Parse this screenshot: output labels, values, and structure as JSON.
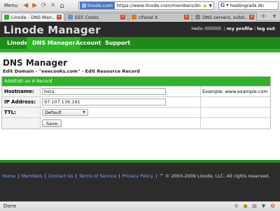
{
  "browser": {
    "menu_label": "Menu",
    "url_domain": "linode.com",
    "url": "https://www.linode.com/members/dns/res",
    "search_text": "hostingrails dn",
    "tabs": [
      {
        "label": "Linode - DNS Man...",
        "icon_color": "#2db524",
        "active": true
      },
      {
        "label": "EEE Cooks",
        "icon_color": "#6b8fd6",
        "active": false
      },
      {
        "label": "cPanel X",
        "icon_color": "#e07a1a",
        "active": false
      },
      {
        "label": "DNS servers, subd...",
        "icon_color": "#888888",
        "active": false
      }
    ],
    "status_text": "Done"
  },
  "site": {
    "logo": "Linode Manager",
    "greeting": "Hello",
    "my_profile": "my profile",
    "log_out": "log out",
    "nav": [
      "Linodes",
      "DNS Manager",
      "Account",
      "Support"
    ],
    "active_nav": "DNS Manager"
  },
  "main": {
    "title": "DNS Manager",
    "subtitle": "Edit Domain - \"eeecooks.com\" - Edit Resource Record",
    "form": {
      "heading": "Add/Edit an A Record",
      "hostname_label": "Hostname:",
      "hostname_value": "beta",
      "hostname_hint": "Example: www.example.com",
      "ip_label": "IP Address:",
      "ip_value": "97.107.136.191",
      "ttl_label": "TTL:",
      "ttl_value": "Default",
      "save_label": "Save"
    }
  },
  "footer": {
    "links": [
      "Home",
      "Members",
      "Contact Us",
      "Terms of Service",
      "Privacy Policy"
    ],
    "copyright": "™ © 2003-2009 Linode, LLC. All rights reserved."
  },
  "colors": {
    "brand_green": "#2db524",
    "nav_green": "#1f8a1a",
    "header_dark": "#2a2a2a"
  }
}
